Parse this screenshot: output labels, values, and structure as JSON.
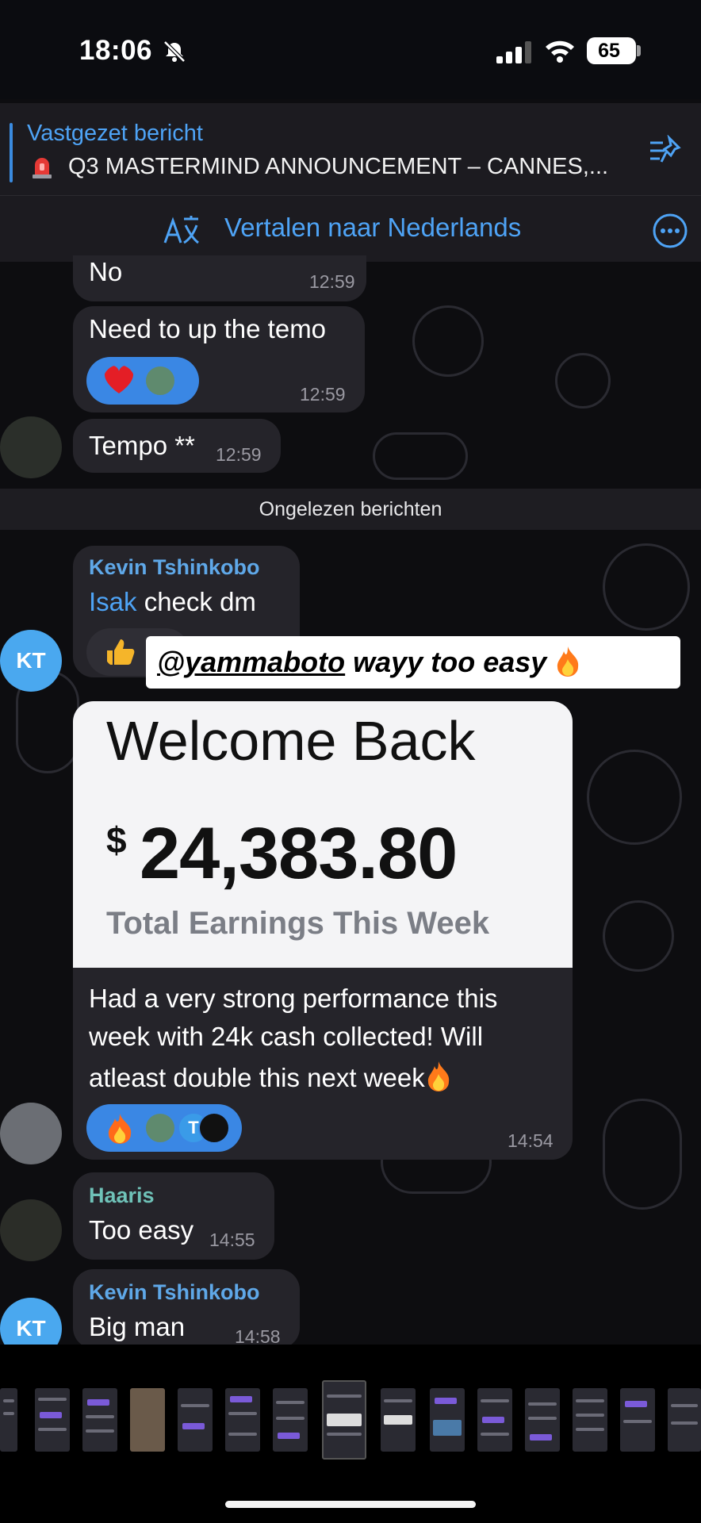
{
  "status_bar": {
    "time": "18:06",
    "battery": "65"
  },
  "pinned": {
    "title": "Vastgezet bericht",
    "text": "Q3 MASTERMIND ANNOUNCEMENT – CANNES,..."
  },
  "translate_bar": {
    "label": "Vertalen naar Nederlands"
  },
  "messages_before": [
    {
      "text": "No",
      "time": "12:59"
    },
    {
      "text": "Need to up the temo",
      "time": "12:59"
    },
    {
      "text": "Tempo **",
      "time": "12:59"
    }
  ],
  "unread_divider": "Ongelezen berichten",
  "kevin_msg_1": {
    "sender": "Kevin Tshinkobo",
    "mention": "Isak",
    "text": " check dm",
    "avatar": "KT"
  },
  "sticker_text": {
    "mention": "@yammaboto",
    "text": " wayy too easy"
  },
  "earnings_card": {
    "heading": "Welcome Back",
    "currency": "$",
    "amount": "24,383.80",
    "caption": "Total Earnings This Week"
  },
  "earnings_msg": {
    "line1": "Had a very strong performance this",
    "line2": "week with 24k cash collected! Will",
    "line3": "atleast double this next week",
    "time": "14:54",
    "reaction_initial": "T"
  },
  "haaris_msg": {
    "sender": "Haaris",
    "text": "Too easy",
    "time": "14:55"
  },
  "kevin_msg_2": {
    "sender": "Kevin Tshinkobo",
    "text": "Big man",
    "time": "14:58",
    "avatar": "KT"
  },
  "colors": {
    "accent": "#4ea3f5",
    "reaction_pill": "#3a87e4",
    "bubble": "#25242a"
  }
}
